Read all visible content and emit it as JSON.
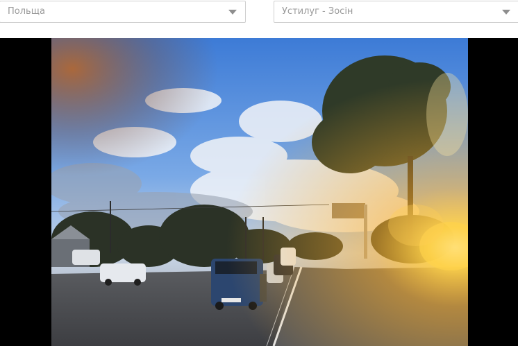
{
  "filters": {
    "country": {
      "selected": "Польща",
      "icon": "chevron-down-icon"
    },
    "checkpoint": {
      "selected": "Устилуг - Зосін",
      "icon": "chevron-down-icon"
    }
  },
  "colors": {
    "background": "#ffffff",
    "select_border": "#cfcfcf",
    "select_text": "#9a9a9a",
    "video_background": "#000000"
  }
}
